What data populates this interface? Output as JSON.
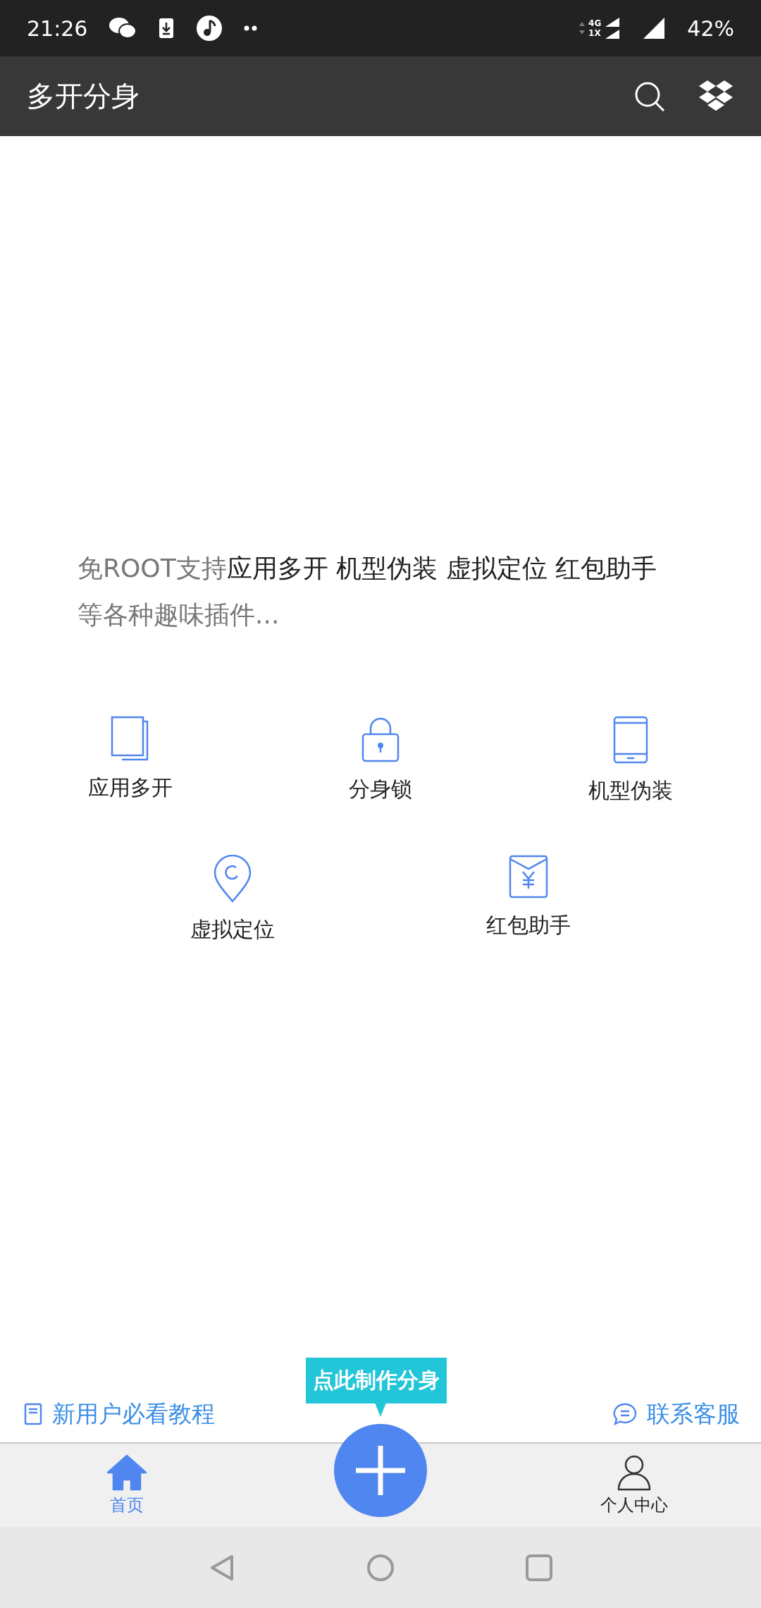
{
  "status_bar": {
    "time": "21:26",
    "network": [
      "4G",
      "1X"
    ],
    "battery": "42%"
  },
  "toolbar": {
    "title": "多开分身"
  },
  "intro": [
    {
      "text": "免ROOT支持",
      "emphasis": false
    },
    {
      "text": "应用多开 机型伪装 虚拟定位 红包助手",
      "emphasis": true
    },
    {
      "text": "等各种趣味插件...",
      "emphasis": false
    }
  ],
  "features": [
    {
      "label": "应用多开",
      "kind": "copies"
    },
    {
      "label": "分身锁",
      "kind": "lock"
    },
    {
      "label": "机型伪装",
      "kind": "phone"
    },
    {
      "label": "虚拟定位",
      "kind": "location"
    },
    {
      "label": "红包助手",
      "kind": "envelope"
    }
  ],
  "links": [
    {
      "label": "新用户必看教程",
      "kind": "guide"
    },
    {
      "label": "联系客服",
      "kind": "chat"
    }
  ],
  "create_tooltip": "点此制作分身",
  "tabs": [
    {
      "label": "首页",
      "kind": "home",
      "selected": true
    },
    {
      "label": "个人中心",
      "kind": "person",
      "selected": false
    }
  ]
}
